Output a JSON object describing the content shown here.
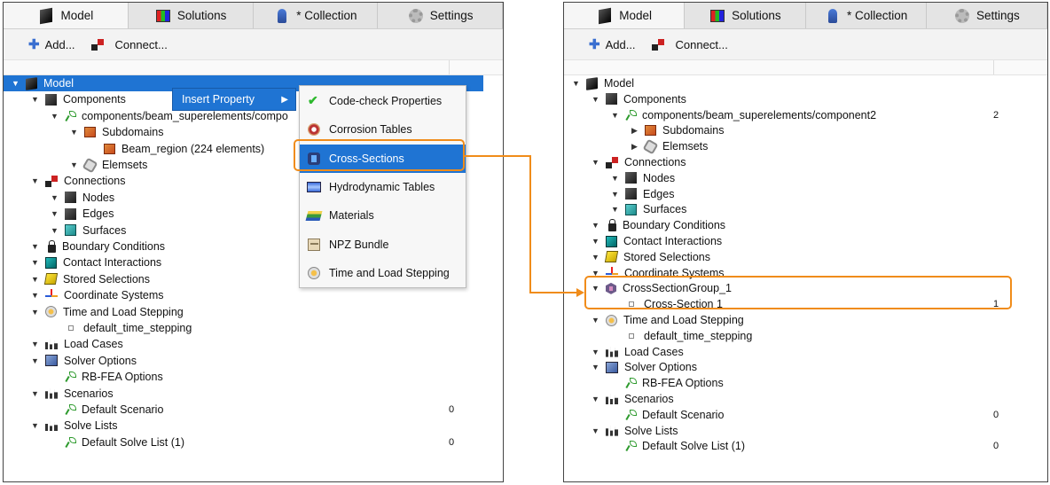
{
  "tabs": [
    "Model",
    "Solutions",
    "* Collection",
    "Settings"
  ],
  "toolbar": {
    "add_label": "Add...",
    "connect_label": "Connect..."
  },
  "left_tree": [
    {
      "label": "Model",
      "icon": "model-icon",
      "arrow": "down",
      "selected": true
    },
    {
      "label": "Components",
      "icon": "components-icon",
      "arrow": "down"
    },
    {
      "label": "components/beam_superelements/compo",
      "icon": "component-leaf-icon",
      "arrow": "down"
    },
    {
      "label": "Subdomains",
      "icon": "subdomains-icon",
      "arrow": "down"
    },
    {
      "label": "Beam_region (224 elements)",
      "icon": "region-icon",
      "arrow": ""
    },
    {
      "label": "Elemsets",
      "icon": "elemsets-icon",
      "arrow": "down"
    },
    {
      "label": "Connections",
      "icon": "connections-icon",
      "arrow": "down"
    },
    {
      "label": "Nodes",
      "icon": "nodes-icon",
      "arrow": "down"
    },
    {
      "label": "Edges",
      "icon": "edges-icon",
      "arrow": "down"
    },
    {
      "label": "Surfaces",
      "icon": "surfaces-icon",
      "arrow": "down"
    },
    {
      "label": "Boundary Conditions",
      "icon": "lock-icon",
      "arrow": "down"
    },
    {
      "label": "Contact Interactions",
      "icon": "contact-icon",
      "arrow": "down"
    },
    {
      "label": "Stored Selections",
      "icon": "stored-selections-icon",
      "arrow": "down"
    },
    {
      "label": "Coordinate Systems",
      "icon": "coordinate-systems-icon",
      "arrow": "down"
    },
    {
      "label": "Time and Load Stepping",
      "icon": "clock-icon",
      "arrow": "down"
    },
    {
      "label": "default_time_stepping",
      "icon": "small-square-icon",
      "arrow": ""
    },
    {
      "label": "Load Cases",
      "icon": "load-cases-icon",
      "arrow": "down"
    },
    {
      "label": "Solver Options",
      "icon": "solver-options-icon",
      "arrow": "down"
    },
    {
      "label": "RB-FEA Options",
      "icon": "leaf-icon",
      "arrow": ""
    },
    {
      "label": "Scenarios",
      "icon": "scenarios-icon",
      "arrow": "down"
    },
    {
      "label": "Default Scenario",
      "icon": "leaf-icon",
      "arrow": "",
      "count": "0"
    },
    {
      "label": "Solve Lists",
      "icon": "solve-lists-icon",
      "arrow": "down"
    },
    {
      "label": "Default Solve List (1)",
      "icon": "leaf-icon",
      "arrow": "",
      "count": "0"
    }
  ],
  "right_tree": [
    {
      "label": "Model",
      "icon": "model-icon",
      "arrow": "down"
    },
    {
      "label": "Components",
      "icon": "components-icon",
      "arrow": "down"
    },
    {
      "label": "components/beam_superelements/component2",
      "icon": "component-leaf-icon",
      "arrow": "down",
      "count": "2"
    },
    {
      "label": "Subdomains",
      "icon": "subdomains-icon",
      "arrow": "right"
    },
    {
      "label": "Elemsets",
      "icon": "elemsets-icon",
      "arrow": "right"
    },
    {
      "label": "Connections",
      "icon": "connections-icon",
      "arrow": "down"
    },
    {
      "label": "Nodes",
      "icon": "nodes-icon",
      "arrow": "down"
    },
    {
      "label": "Edges",
      "icon": "edges-icon",
      "arrow": "down"
    },
    {
      "label": "Surfaces",
      "icon": "surfaces-icon",
      "arrow": "down"
    },
    {
      "label": "Boundary Conditions",
      "icon": "lock-icon",
      "arrow": "down"
    },
    {
      "label": "Contact Interactions",
      "icon": "contact-icon",
      "arrow": "down"
    },
    {
      "label": "Stored Selections",
      "icon": "stored-selections-icon",
      "arrow": "down"
    },
    {
      "label": "Coordinate Systems",
      "icon": "coordinate-systems-icon",
      "arrow": "down"
    },
    {
      "label": "CrossSectionGroup_1",
      "icon": "cross-section-group-icon",
      "arrow": "down"
    },
    {
      "label": "Cross-Section 1",
      "icon": "small-square-icon",
      "arrow": "",
      "count": "1"
    },
    {
      "label": "Time and Load Stepping",
      "icon": "clock-icon",
      "arrow": "down"
    },
    {
      "label": "default_time_stepping",
      "icon": "small-square-icon",
      "arrow": ""
    },
    {
      "label": "Load Cases",
      "icon": "load-cases-icon",
      "arrow": "down"
    },
    {
      "label": "Solver Options",
      "icon": "solver-options-icon",
      "arrow": "down"
    },
    {
      "label": "RB-FEA Options",
      "icon": "leaf-icon",
      "arrow": ""
    },
    {
      "label": "Scenarios",
      "icon": "scenarios-icon",
      "arrow": "down"
    },
    {
      "label": "Default Scenario",
      "icon": "leaf-icon",
      "arrow": "",
      "count": "0"
    },
    {
      "label": "Solve Lists",
      "icon": "solve-lists-icon",
      "arrow": "down"
    },
    {
      "label": "Default Solve List (1)",
      "icon": "leaf-icon",
      "arrow": "",
      "count": "0"
    }
  ],
  "context_menu": {
    "insert_property_label": "Insert Property"
  },
  "submenu": [
    {
      "label": "Code-check Properties",
      "icon": "checkmark-icon"
    },
    {
      "label": "Corrosion Tables",
      "icon": "corrosion-icon"
    },
    {
      "label": "Cross-Sections",
      "icon": "cross-sections-icon",
      "highlighted": true
    },
    {
      "label": "Hydrodynamic Tables",
      "icon": "hydrodynamic-icon"
    },
    {
      "label": "Materials",
      "icon": "materials-icon"
    },
    {
      "label": "NPZ Bundle",
      "icon": "npz-bundle-icon"
    },
    {
      "label": "Time and Load Stepping",
      "icon": "clock-icon"
    }
  ],
  "colors": {
    "selection": "#1f74d3",
    "highlight_outline": "#f08c1a"
  }
}
